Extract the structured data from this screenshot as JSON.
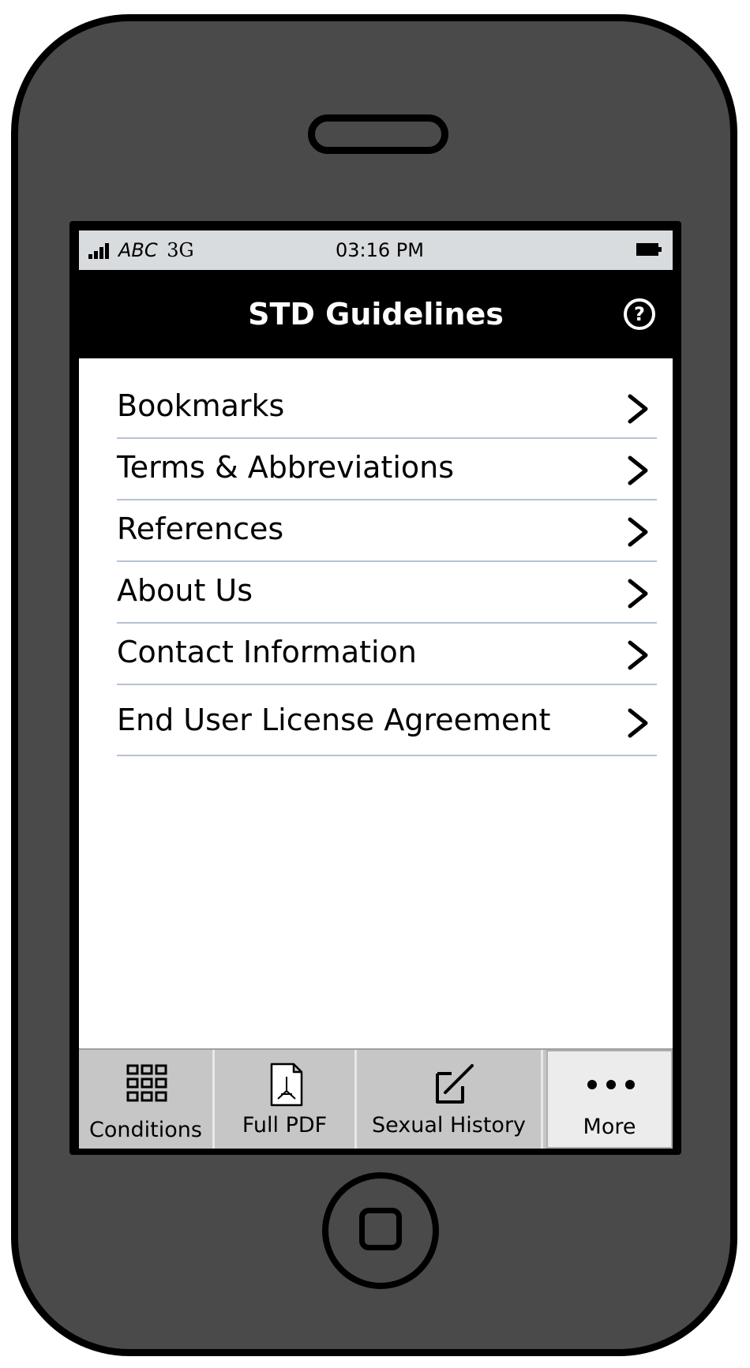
{
  "status_bar": {
    "carrier": "ABC",
    "network": "3G",
    "time": "03:16 PM"
  },
  "nav_bar": {
    "title": "STD Guidelines",
    "help_icon": "help-icon",
    "help_glyph": "?"
  },
  "menu": {
    "items": [
      {
        "label": "Bookmarks"
      },
      {
        "label": "Terms & Abbreviations"
      },
      {
        "label": "References"
      },
      {
        "label": "About Us"
      },
      {
        "label": "Contact Information"
      },
      {
        "label": "End User License Agreement"
      }
    ],
    "chevron_icon": "chevron-right-icon"
  },
  "tab_bar": {
    "tabs": [
      {
        "label": "Conditions",
        "icon": "grid-icon",
        "active": false
      },
      {
        "label": "Full PDF",
        "icon": "pdf-document-icon",
        "active": false
      },
      {
        "label": "Sexual History",
        "icon": "edit-icon",
        "active": false
      },
      {
        "label": "More",
        "icon": "more-dots-icon",
        "active": true
      }
    ]
  },
  "colors": {
    "phone_body": "#4a4a4a",
    "status_bar": "#d8dcde",
    "nav_bar": "#000000",
    "divider": "#b7c1d6",
    "tab_bar": "#c6c6c6",
    "tab_active": "#ececec"
  }
}
